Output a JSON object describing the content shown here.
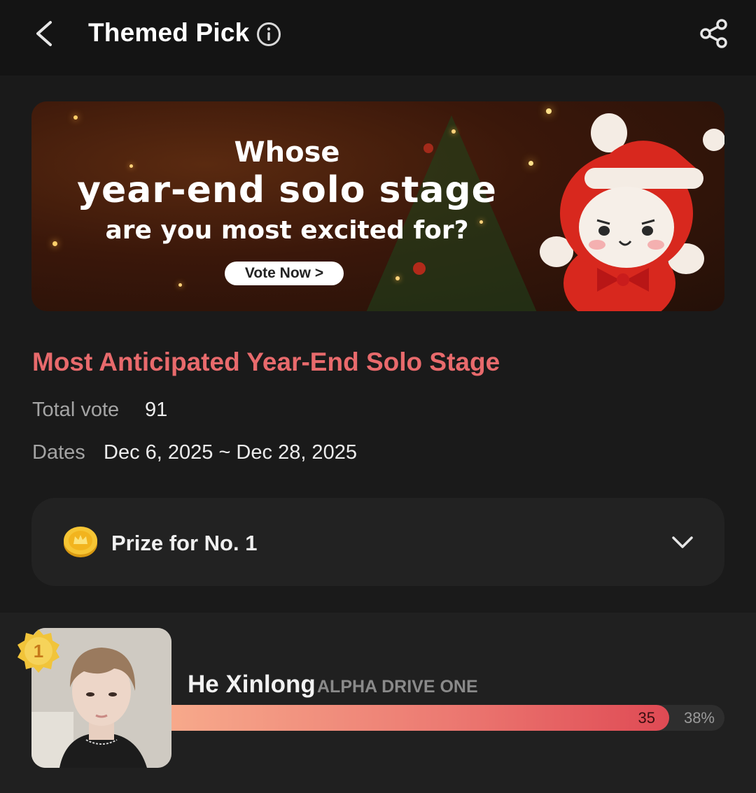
{
  "header": {
    "title": "Themed Pick",
    "icons": [
      "back-arrow-icon",
      "info-icon",
      "share-icon"
    ]
  },
  "banner": {
    "line1": "Whose",
    "line2": "year-end solo stage",
    "line3": "are you most excited for?",
    "cta": "Vote Now >"
  },
  "event": {
    "title": "Most Anticipated Year-End Solo Stage",
    "total_vote_label": "Total vote",
    "total_vote_value": "91",
    "dates_label": "Dates",
    "dates_value": "Dec 6, 2025 ~ Dec 28, 2025"
  },
  "prize": {
    "label": "Prize for No. 1",
    "icon": "coin-icon",
    "toggle_icon": "chevron-down-icon"
  },
  "ranking": [
    {
      "rank": "1",
      "name": "He Xinlong",
      "group": "ALPHA DRIVE ONE",
      "votes": "35",
      "percent": "38%",
      "share_fraction": 0.9
    }
  ],
  "colors": {
    "accent": "#e86a6c",
    "background": "#1a1a1a",
    "card": "#222222",
    "bar_start": "#f7a98b",
    "bar_end": "#df4a54"
  }
}
